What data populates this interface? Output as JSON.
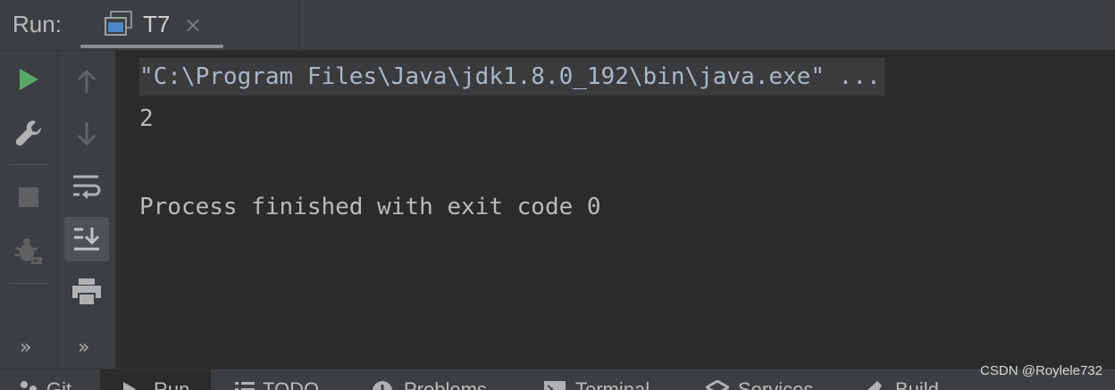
{
  "header": {
    "run_label": "Run:",
    "tab": {
      "title": "T7",
      "close": "×",
      "icon": "console-window-icon"
    }
  },
  "toolbar_left": {
    "buttons": [
      {
        "name": "rerun",
        "icon": "play-icon",
        "color": "#59a869"
      },
      {
        "name": "edit-configuration",
        "icon": "wrench-icon"
      },
      {
        "name": "stop",
        "icon": "stop-icon",
        "disabled": true
      },
      {
        "name": "debug",
        "icon": "bug-icon",
        "disabled": true
      }
    ],
    "more": "»"
  },
  "toolbar_second": {
    "buttons": [
      {
        "name": "scroll-up",
        "icon": "arrow-up-icon",
        "disabled": true
      },
      {
        "name": "scroll-down",
        "icon": "arrow-down-icon",
        "disabled": true
      },
      {
        "name": "soft-wrap",
        "icon": "soft-wrap-icon"
      },
      {
        "name": "scroll-to-end",
        "icon": "scroll-to-end-icon",
        "active": true
      },
      {
        "name": "print",
        "icon": "print-icon"
      }
    ],
    "more": "»"
  },
  "console": {
    "command": "\"C:\\Program Files\\Java\\jdk1.8.0_192\\bin\\java.exe\" ...",
    "output": "2",
    "exit": "Process finished with exit code 0"
  },
  "bottom_tabs": [
    {
      "label": "Git",
      "icon": "git-icon"
    },
    {
      "label": "Run",
      "icon": "run-icon",
      "active": true
    },
    {
      "label": "TODO",
      "icon": "todo-icon"
    },
    {
      "label": "Problems",
      "icon": "problems-icon"
    },
    {
      "label": "Terminal",
      "icon": "terminal-icon"
    },
    {
      "label": "Services",
      "icon": "services-icon"
    },
    {
      "label": "Build",
      "icon": "build-icon"
    }
  ],
  "watermark": "CSDN @Roylele732",
  "colors": {
    "panel": "#3c3f41",
    "editor": "#2b2b2b",
    "run_green": "#59a869",
    "command_text": "#a9b7c6"
  }
}
